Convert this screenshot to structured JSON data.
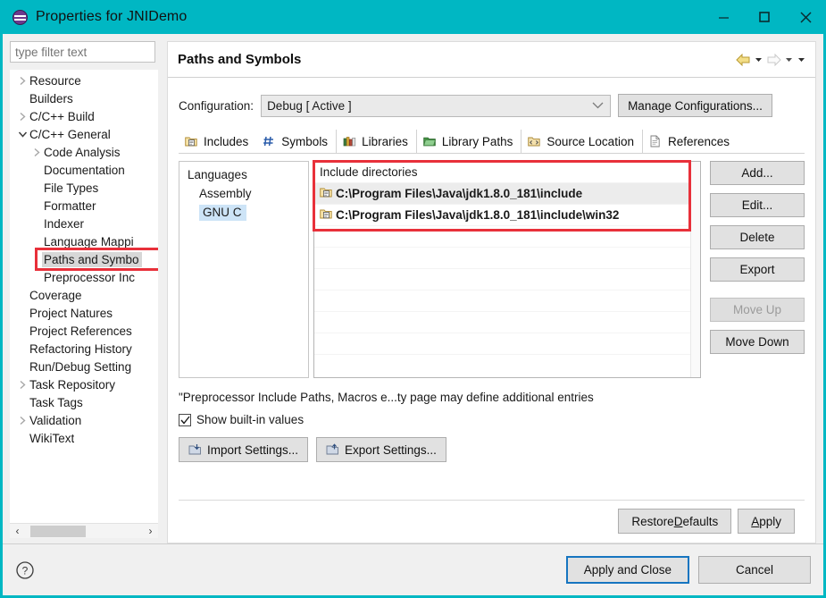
{
  "window": {
    "title": "Properties for JNIDemo",
    "icon": "eclipse-properties-icon",
    "controls": {
      "minimize": "Minimize",
      "maximize": "Maximize",
      "close": "Close"
    },
    "titlebar_color": "#00b7c3"
  },
  "sidebar": {
    "filter_placeholder": "type filter text",
    "filter_value": "",
    "items": [
      {
        "label": "Resource",
        "indent": 0,
        "arrow": "collapsed"
      },
      {
        "label": "Builders",
        "indent": 0,
        "arrow": "none"
      },
      {
        "label": "C/C++ Build",
        "indent": 0,
        "arrow": "collapsed"
      },
      {
        "label": "C/C++ General",
        "indent": 0,
        "arrow": "expanded"
      },
      {
        "label": "Code Analysis",
        "indent": 1,
        "arrow": "collapsed"
      },
      {
        "label": "Documentation",
        "indent": 1,
        "arrow": "none"
      },
      {
        "label": "File Types",
        "indent": 1,
        "arrow": "none"
      },
      {
        "label": "Formatter",
        "indent": 1,
        "arrow": "none"
      },
      {
        "label": "Indexer",
        "indent": 1,
        "arrow": "none"
      },
      {
        "label": "Language Mappi",
        "indent": 1,
        "arrow": "none"
      },
      {
        "label": "Paths and Symbo",
        "indent": 1,
        "arrow": "none",
        "selected": true
      },
      {
        "label": "Preprocessor Inc",
        "indent": 1,
        "arrow": "none"
      },
      {
        "label": "Coverage",
        "indent": 0,
        "arrow": "none"
      },
      {
        "label": "Project Natures",
        "indent": 0,
        "arrow": "none"
      },
      {
        "label": "Project References",
        "indent": 0,
        "arrow": "none"
      },
      {
        "label": "Refactoring History",
        "indent": 0,
        "arrow": "none"
      },
      {
        "label": "Run/Debug Setting",
        "indent": 0,
        "arrow": "none"
      },
      {
        "label": "Task Repository",
        "indent": 0,
        "arrow": "collapsed"
      },
      {
        "label": "Task Tags",
        "indent": 0,
        "arrow": "none"
      },
      {
        "label": "Validation",
        "indent": 0,
        "arrow": "collapsed"
      },
      {
        "label": "WikiText",
        "indent": 0,
        "arrow": "none"
      }
    ],
    "scroll_left": "‹",
    "scroll_right": "›"
  },
  "pane": {
    "title": "Paths and Symbols",
    "nav": {
      "back": "back-arrow",
      "back_menu": "back-dropdown",
      "forward": "forward-arrow",
      "forward_menu": "forward-dropdown",
      "extra_menu": "view-menu",
      "back_color": "#f5dc6e",
      "forward_color": "#d8d8d8"
    },
    "configuration": {
      "label": "Configuration:",
      "value": "Debug  [ Active ]",
      "manage_button": "Manage Configurations..."
    },
    "tabs": [
      {
        "label": "Includes",
        "icon": "include-folder-icon",
        "active": true
      },
      {
        "label": "Symbols",
        "icon": "hash-icon",
        "active": false
      },
      {
        "label": "Libraries",
        "icon": "books-icon",
        "active": false
      },
      {
        "label": "Library Paths",
        "icon": "open-folder-icon",
        "active": false
      },
      {
        "label": "Source Location",
        "icon": "source-folder-icon",
        "active": false
      },
      {
        "label": "References",
        "icon": "document-icon",
        "active": false
      }
    ],
    "languages": {
      "header": "Languages",
      "items": [
        {
          "label": "Assembly",
          "selected": false
        },
        {
          "label": "GNU C",
          "selected": true
        }
      ]
    },
    "includes": {
      "header": "Include directories",
      "entries": [
        {
          "path": "C:\\Program Files\\Java\\jdk1.8.0_181\\include",
          "icon": "folder-include-icon",
          "shaded": true
        },
        {
          "path": "C:\\Program Files\\Java\\jdk1.8.0_181\\include\\win32",
          "icon": "folder-include-icon",
          "shaded": false
        }
      ]
    },
    "side_buttons": [
      {
        "label": "Add...",
        "disabled": false
      },
      {
        "label": "Edit...",
        "disabled": false
      },
      {
        "label": "Delete",
        "disabled": false
      },
      {
        "label": "Export",
        "disabled": false
      },
      {
        "label": "Move Up",
        "disabled": true
      },
      {
        "label": "Move Down",
        "disabled": false
      }
    ],
    "note": "\"Preprocessor Include Paths, Macros e...ty page may define additional entries",
    "checkbox": {
      "label": "Show built-in values",
      "checked": true
    },
    "settings_buttons": [
      {
        "label": "Import Settings...",
        "icon": "import-icon"
      },
      {
        "label": "Export Settings...",
        "icon": "export-icon"
      }
    ],
    "bottom_buttons": [
      {
        "label_pre": "Restore ",
        "mnemonic": "D",
        "label_post": "efaults"
      },
      {
        "label_pre": "",
        "mnemonic": "A",
        "label_post": "pply"
      }
    ]
  },
  "footer": {
    "help_icon": "help-question-icon",
    "apply_and_close": "Apply and Close",
    "cancel": "Cancel",
    "default_focus_color": "#1675c0"
  },
  "annotations": {
    "sidebar_highlight": "red-box-paths-and-symbols",
    "includes_highlight": "red-box-include-directories",
    "color": "#e8303a"
  }
}
